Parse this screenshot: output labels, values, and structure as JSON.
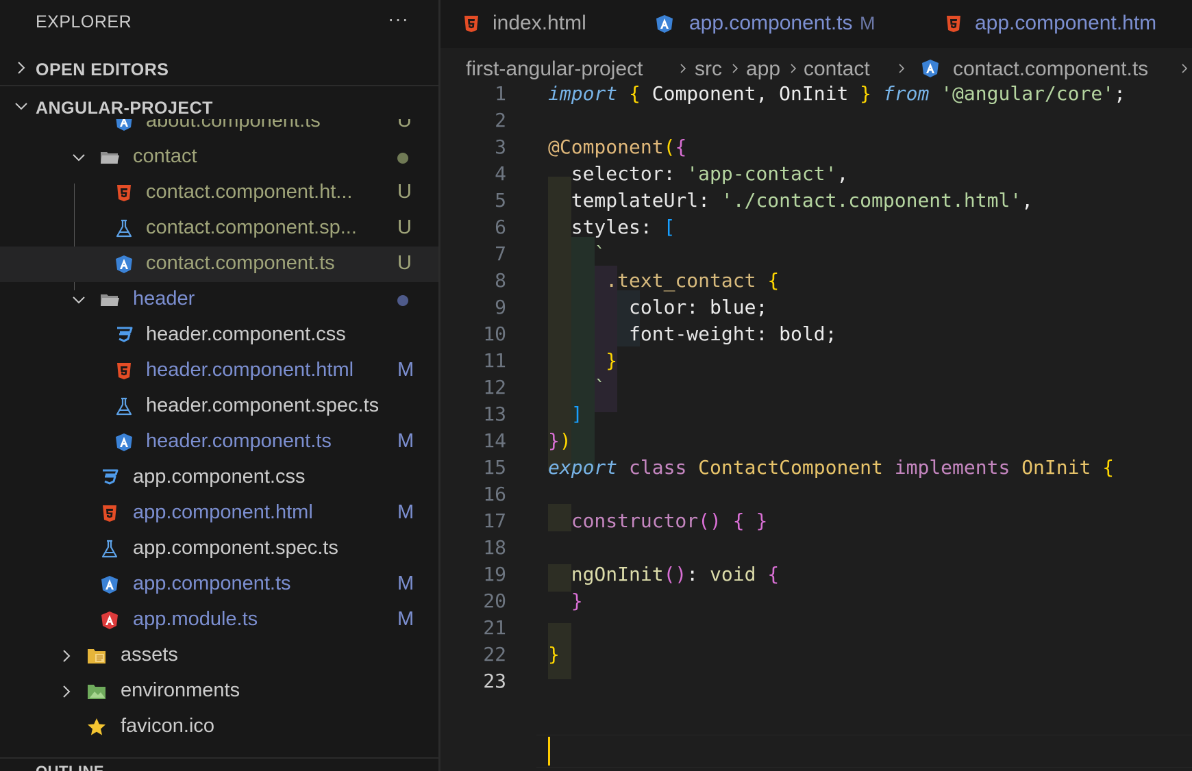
{
  "sidebar": {
    "title": "EXPLORER",
    "more_icon": "ellipsis-icon",
    "sections": {
      "open_editors": "OPEN EDITORS",
      "project": "ANGULAR-PROJECT",
      "outline": "OUTLINE"
    },
    "tree": [
      {
        "name": "about.component.ts",
        "badge": "U",
        "icon": "angular-icon",
        "color": "#a0a57a"
      },
      {
        "name": "contact",
        "type": "folder",
        "expanded": true,
        "dot": true,
        "icon": "folder-open-icon",
        "color": "#a0a57a"
      },
      {
        "name": "contact.component.ht...",
        "badge": "U",
        "icon": "html5-icon",
        "color": "#a0a57a"
      },
      {
        "name": "contact.component.sp...",
        "badge": "U",
        "icon": "test-flask-icon",
        "color": "#a0a57a"
      },
      {
        "name": "contact.component.ts",
        "badge": "U",
        "icon": "angular-icon",
        "color": "#a0a57a",
        "selected": true
      },
      {
        "name": "header",
        "type": "folder",
        "expanded": true,
        "dot": true,
        "icon": "folder-open-icon",
        "color": "#7c8fd1"
      },
      {
        "name": "header.component.css",
        "icon": "css3-icon",
        "color": "#cccccc"
      },
      {
        "name": "header.component.html",
        "badge": "M",
        "icon": "html5-icon",
        "color": "#7c8fd1"
      },
      {
        "name": "header.component.spec.ts",
        "icon": "test-flask-icon",
        "color": "#cccccc"
      },
      {
        "name": "header.component.ts",
        "badge": "M",
        "icon": "angular-icon",
        "color": "#7c8fd1"
      },
      {
        "name": "app.component.css",
        "icon": "css3-icon",
        "color": "#cccccc"
      },
      {
        "name": "app.component.html",
        "badge": "M",
        "icon": "html5-icon",
        "color": "#7c8fd1"
      },
      {
        "name": "app.component.spec.ts",
        "icon": "test-flask-icon",
        "color": "#cccccc"
      },
      {
        "name": "app.component.ts",
        "badge": "M",
        "icon": "angular-icon",
        "color": "#7c8fd1"
      },
      {
        "name": "app.module.ts",
        "badge": "M",
        "icon": "angular-module-icon",
        "color": "#7c8fd1"
      },
      {
        "name": "assets",
        "type": "folder",
        "expanded": false,
        "icon": "assets-folder-icon",
        "color": "#cccccc"
      },
      {
        "name": "environments",
        "type": "folder",
        "expanded": false,
        "icon": "environments-folder-icon",
        "color": "#cccccc"
      },
      {
        "name": "favicon.ico",
        "icon": "star-icon",
        "color": "#cccccc"
      }
    ]
  },
  "tabs": [
    {
      "name": "index.html",
      "icon": "html5-icon",
      "badge": ""
    },
    {
      "name": "app.component.ts",
      "icon": "angular-icon",
      "badge": "M"
    },
    {
      "name": "app.component.htm",
      "icon": "html5-icon",
      "badge": ""
    }
  ],
  "breadcrumb": [
    "first-angular-project",
    "src",
    "app",
    "contact",
    "contact.component.ts"
  ],
  "editor": {
    "line_numbers": [
      "1",
      "2",
      "3",
      "4",
      "5",
      "6",
      "7",
      "8",
      "9",
      "10",
      "11",
      "12",
      "13",
      "14",
      "15",
      "16",
      "17",
      "18",
      "19",
      "20",
      "21",
      "22",
      "23"
    ],
    "active_line": "23"
  },
  "colors": {
    "untracked": "#a0a57a",
    "modified": "#7c8fd1",
    "keyword_italic": "#78b4e8",
    "string": "#b5d5a0",
    "cursor": "#ffcc00"
  }
}
